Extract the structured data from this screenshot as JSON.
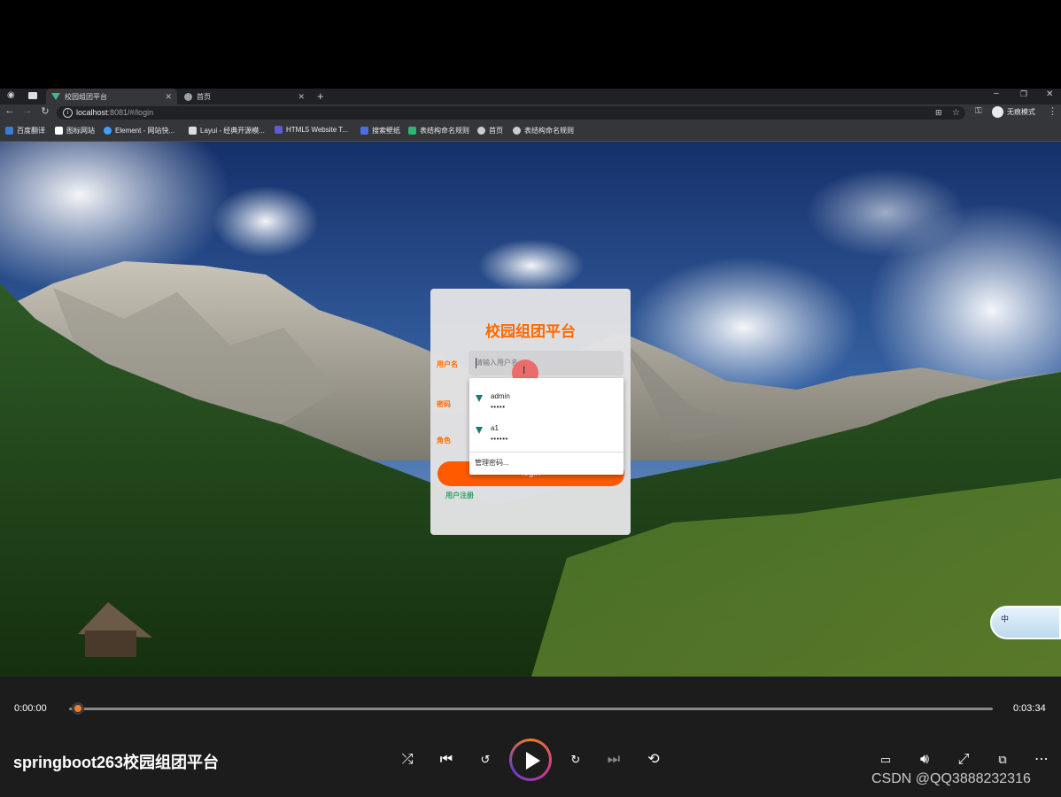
{
  "browser": {
    "tabs": [
      {
        "label": "校园组团平台",
        "active": true
      },
      {
        "label": "首页",
        "active": false
      }
    ],
    "url": {
      "host": "localhost",
      "rest": ":8081/#/login"
    },
    "profile_label": "无痕模式",
    "bookmarks": [
      {
        "label": "百度翻译",
        "color": "#3a7bd5"
      },
      {
        "label": "图标网站",
        "color": "#ffffff"
      },
      {
        "label": "Element - 网站快...",
        "color": "#409eff"
      },
      {
        "label": "Layui - 经典开源模...",
        "color": "#dddddd"
      },
      {
        "label": "HTML5 Website T...",
        "color": "#5b5bd6"
      },
      {
        "label": "搜索壁纸",
        "color": "#4a6ee0"
      },
      {
        "label": "表结构命名规则",
        "color": "#2bb673"
      },
      {
        "label": "首页",
        "color": "#cccccc"
      },
      {
        "label": "表结构命名规则",
        "color": "#cccccc"
      }
    ]
  },
  "login": {
    "title": "校园组团平台",
    "username_label": "用户名",
    "password_label": "密码",
    "role_label": "角色",
    "username_placeholder": "请输入用户名",
    "login_button": "login",
    "register_link": "用户注册"
  },
  "autofill": {
    "items": [
      {
        "user": "admin",
        "pass": "•••••"
      },
      {
        "user": "a1",
        "pass": "••••••"
      }
    ],
    "manage": "管理密码..."
  },
  "ime": {
    "char": "中"
  },
  "player": {
    "current_time": "0:00:00",
    "total_time": "0:03:34",
    "progress": 0.0,
    "title": "springboot263校园组团平台",
    "watermark": "CSDN @QQ3888232316"
  }
}
